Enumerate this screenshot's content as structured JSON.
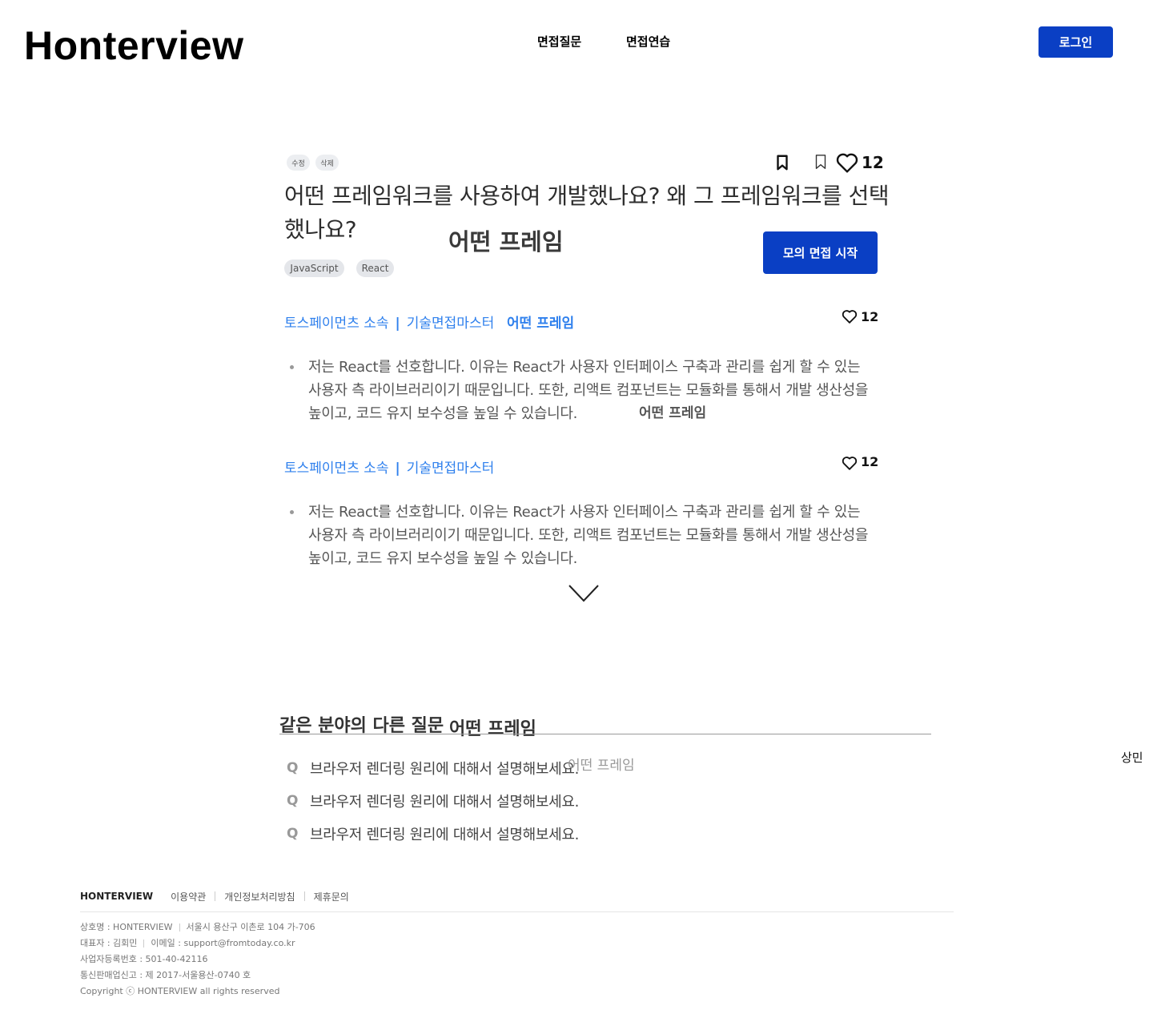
{
  "header": {
    "logo": "Honterview",
    "nav": [
      "면접질문",
      "면접연습"
    ],
    "login": "로그인"
  },
  "question": {
    "edit": "수정",
    "delete": "삭제",
    "like_count": "12",
    "title": "어떤 프레임워크를 사용하여 개발했나요? 왜 그 프레임워크를 선택했나요?",
    "tags": [
      "JavaScript",
      "React"
    ],
    "mock_button": "모의 면접 시작"
  },
  "ghost_text": "어떤 프레임",
  "answers": [
    {
      "company": "토스페이먼츠 소속",
      "separator": "|",
      "author": "기술면접마스터",
      "likes": "12",
      "body": "저는 React를 선호합니다. 이유는 React가 사용자 인터페이스 구축과 관리를 쉽게 할 수 있는 사용자 측 라이브러리이기 때문입니다. 또한, 리액트 컴포넌트는 모듈화를 통해서 개발 생산성을 높이고, 코드 유지 보수성을 높일 수 있습니다."
    },
    {
      "company": "토스페이먼츠 소속",
      "separator": "|",
      "author": "기술면접마스터",
      "likes": "12",
      "body": "저는 React를 선호합니다. 이유는 React가 사용자 인터페이스 구축과 관리를 쉽게 할 수 있는 사용자 측 라이브러리이기 때문입니다. 또한, 리액트 컴포넌트는 모듈화를 통해서 개발 생산성을 높이고, 코드 유지 보수성을 높일 수 있습니다."
    }
  ],
  "related": {
    "title": "같은 분야의 다른 질문",
    "side_text": "상민",
    "items": [
      {
        "q": "Q",
        "text": "브라우저 렌더링 원리에 대해서 설명해보세요."
      },
      {
        "q": "Q",
        "text": "브라우저 렌더링 원리에 대해서 설명해보세요."
      },
      {
        "q": "Q",
        "text": "브라우저 렌더링 원리에 대해서 설명해보세요."
      }
    ]
  },
  "footer": {
    "brand": "HONTERVIEW",
    "links": [
      "이용약관",
      "개인정보처리방침",
      "제휴문의"
    ],
    "company_name": "상호명 : HONTERVIEW",
    "address": "서울시 용산구 이촌로 104 가-706",
    "ceo": "대표자 : 김회민",
    "email": "이메일 : support@fromtoday.co.kr",
    "biz_number": "사업자등록번호 : 501-40-42116",
    "mail_order": "통신판매업신고 : 제 2017-서울용산-0740 호",
    "copyright": "Copyright ⓒ HONTERVIEW all rights reserved"
  },
  "colors": {
    "primary": "#0a3fc4",
    "link_blue": "#2f80ed"
  },
  "icons": [
    "bookmark-icon",
    "bookmark-outline-icon",
    "heart-icon",
    "chevron-down-icon"
  ]
}
